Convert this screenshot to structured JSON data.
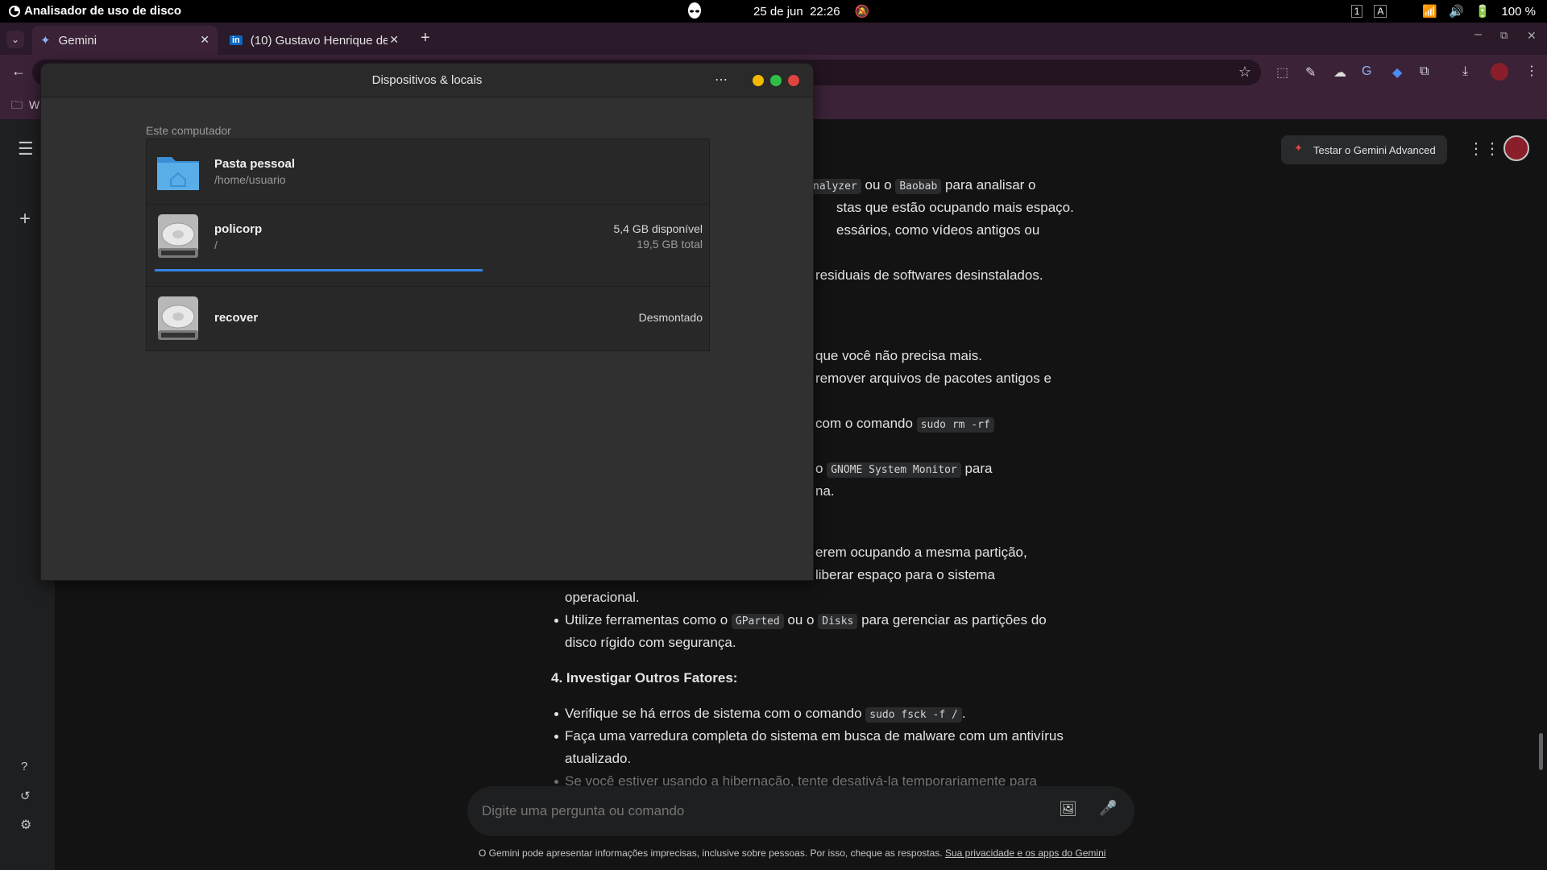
{
  "topbar": {
    "app_name": "Analisador de uso de disco",
    "date": "25 de jun",
    "time": "22:26",
    "battery": "100 %"
  },
  "browser": {
    "tabs": [
      {
        "label": "Gemini",
        "icon": "gemini-spark-icon"
      },
      {
        "label": "(10) Gustavo Henrique de",
        "icon": "linkedin-icon"
      }
    ],
    "bookmark_folder": "W"
  },
  "gemini": {
    "advanced_button": "Testar o Gemini Advanced",
    "lines": {
      "l1a": "nalyzer",
      "l1b": " ou o ",
      "l1c": "Baobab",
      "l1d": " para analisar o",
      "l2": "stas que estão ocupando mais espaço.",
      "l3": "essários, como vídeos antigos ou",
      "l4": " residuais de softwares desinstalados.",
      "l5": " que você não precisa mais.",
      "l6": "remover arquivos de pacotes antigos e",
      "l7a": " com o comando ",
      "l7b": "sudo rm -rf",
      "l8a": " o ",
      "l8b": "GNOME System Monitor",
      "l8c": " para",
      "l9": "na.",
      "l10": "erem ocupando a mesma partição,",
      "l11": " liberar espaço para o sistema",
      "l12": "operacional.",
      "l13a": "Utilize ferramentas como o ",
      "l13b": "GParted",
      "l13c": " ou o ",
      "l13d": "Disks",
      "l13e": " para gerenciar as partições do",
      "l14": "disco rígido com segurança.",
      "heading4": "4. Investigar Outros Fatores:",
      "l15a": "Verifique se há erros de sistema com o comando ",
      "l15b": "sudo fsck -f /",
      "l15c": ".",
      "l16": "Faça uma varredura completa do sistema em busca de malware com um antivírus",
      "l17": "atualizado.",
      "l18": "Se você estiver usando a hibernação, tente desativá-la temporariamente para"
    },
    "prompt_placeholder": "Digite uma pergunta ou comando",
    "footer_text": "O Gemini pode apresentar informações imprecisas, inclusive sobre pessoas. Por isso, cheque as respostas. ",
    "footer_link": "Sua privacidade e os apps do Gemini"
  },
  "disk_window": {
    "title": "Dispositivos & locais",
    "section": "Este computador",
    "items": [
      {
        "name": "Pasta pessoal",
        "path": "/home/usuario",
        "icon": "home-folder-icon"
      },
      {
        "name": "policorp",
        "path": "/",
        "available": "5,4 GB disponível",
        "total": "19,5 GB total",
        "used_fraction": 0.6,
        "icon": "hard-disk-icon"
      },
      {
        "name": "recover",
        "status": "Desmontado",
        "icon": "hard-disk-icon"
      }
    ]
  },
  "colors": {
    "accent_blue": "#3584e4",
    "close_red": "#e0443e",
    "max_green": "#2fbf47",
    "min_yellow": "#f5b800"
  }
}
